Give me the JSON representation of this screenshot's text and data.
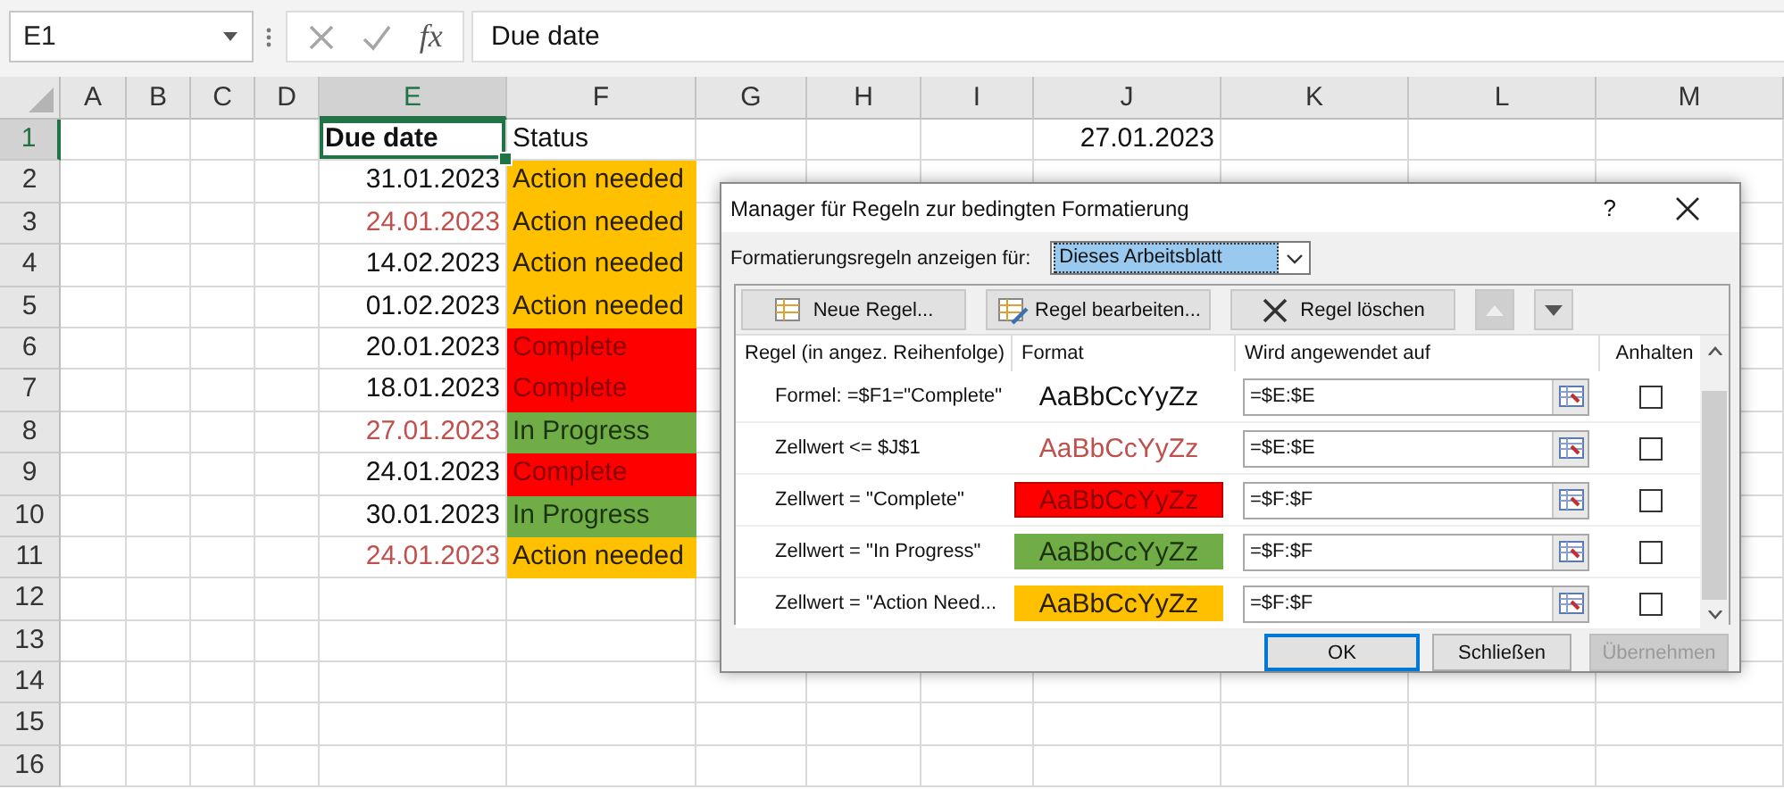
{
  "formula_bar": {
    "name_box": "E1",
    "function_label": "fx",
    "value": "Due date"
  },
  "columns": [
    "A",
    "B",
    "C",
    "D",
    "E",
    "F",
    "G",
    "H",
    "I",
    "J",
    "K",
    "L",
    "M"
  ],
  "rows": [
    {
      "number": "1",
      "cells": [
        null,
        null,
        null,
        null,
        {
          "text": "Due date",
          "kind": "heading",
          "selected": true
        },
        {
          "text": "Status",
          "kind": "label",
          "selected": false
        },
        null,
        null,
        null,
        {
          "text": "27.01.2023",
          "kind": "date",
          "overdue": false,
          "selected": false
        }
      ]
    },
    {
      "number": "2",
      "cells": [
        null,
        null,
        null,
        null,
        {
          "text": "31.01.2023",
          "kind": "date",
          "overdue": false,
          "selected": false
        },
        {
          "text": "Action needed",
          "kind": "action-needed",
          "selected": false
        }
      ]
    },
    {
      "number": "3",
      "cells": [
        null,
        null,
        null,
        null,
        {
          "text": "24.01.2023",
          "kind": "date",
          "overdue": true,
          "selected": false
        },
        {
          "text": "Action needed",
          "kind": "action-needed",
          "selected": false
        }
      ]
    },
    {
      "number": "4",
      "cells": [
        null,
        null,
        null,
        null,
        {
          "text": "14.02.2023",
          "kind": "date",
          "overdue": false,
          "selected": false
        },
        {
          "text": "Action needed",
          "kind": "action-needed",
          "selected": false
        }
      ]
    },
    {
      "number": "5",
      "cells": [
        null,
        null,
        null,
        null,
        {
          "text": "01.02.2023",
          "kind": "date",
          "overdue": false,
          "selected": false
        },
        {
          "text": "Action needed",
          "kind": "action-needed",
          "selected": false
        }
      ]
    },
    {
      "number": "6",
      "cells": [
        null,
        null,
        null,
        null,
        {
          "text": "20.01.2023",
          "kind": "date",
          "overdue": false,
          "selected": false
        },
        {
          "text": "Complete",
          "kind": "complete",
          "selected": false
        }
      ]
    },
    {
      "number": "7",
      "cells": [
        null,
        null,
        null,
        null,
        {
          "text": "18.01.2023",
          "kind": "date",
          "overdue": false,
          "selected": false
        },
        {
          "text": "Complete",
          "kind": "complete",
          "selected": false
        }
      ]
    },
    {
      "number": "8",
      "cells": [
        null,
        null,
        null,
        null,
        {
          "text": "27.01.2023",
          "kind": "date",
          "overdue": true,
          "selected": false
        },
        {
          "text": "In Progress",
          "kind": "in-progress",
          "selected": false
        }
      ]
    },
    {
      "number": "9",
      "cells": [
        null,
        null,
        null,
        null,
        {
          "text": "24.01.2023",
          "kind": "date",
          "overdue": false,
          "selected": false
        },
        {
          "text": "Complete",
          "kind": "complete",
          "selected": false
        }
      ]
    },
    {
      "number": "10",
      "cells": [
        null,
        null,
        null,
        null,
        {
          "text": "30.01.2023",
          "kind": "date",
          "overdue": false,
          "selected": false
        },
        {
          "text": "In Progress",
          "kind": "in-progress",
          "selected": false
        }
      ]
    },
    {
      "number": "11",
      "cells": [
        null,
        null,
        null,
        null,
        {
          "text": "24.01.2023",
          "kind": "date",
          "overdue": true,
          "selected": false
        },
        {
          "text": "Action needed",
          "kind": "action-needed",
          "selected": false
        }
      ]
    },
    {
      "number": "12",
      "cells": []
    },
    {
      "number": "13",
      "cells": []
    },
    {
      "number": "14",
      "cells": []
    },
    {
      "number": "15",
      "cells": []
    },
    {
      "number": "16",
      "cells": []
    }
  ],
  "dialog": {
    "title": "Manager für Regeln zur bedingten Formatierung",
    "help": "?",
    "scope_label": "Formatierungsregeln anzeigen für:",
    "scope_value": "Dieses Arbeitsblatt",
    "toolbar": [
      {
        "kind": "new",
        "label": "Neue Regel...",
        "disabled": false
      },
      {
        "kind": "edit",
        "label": "Regel bearbeiten...",
        "disabled": false
      },
      {
        "kind": "delete",
        "label": "Regel löschen",
        "disabled": false
      },
      {
        "kind": "up",
        "disabled": true
      },
      {
        "kind": "down",
        "disabled": false
      }
    ],
    "columns": [
      "Regel (in angez. Reihenfolge)",
      "Format",
      "Wird angewendet auf",
      "Anhalten"
    ],
    "rules": [
      {
        "rule": "Formel: =$F1=\"Complete\"",
        "preview": "AaBbCcYyZz",
        "kind": "plain",
        "applies_to": "=$E:$E",
        "checked": false,
        "selected": false
      },
      {
        "rule": "Zellwert <= $J$1",
        "preview": "AaBbCcYyZz",
        "kind": "red-text",
        "applies_to": "=$E:$E",
        "checked": false,
        "selected": false
      },
      {
        "rule": "Zellwert = \"Complete\"",
        "preview": "AaBbCcYyZz",
        "kind": "red-fill",
        "applies_to": "=$F:$F",
        "checked": false,
        "selected": false
      },
      {
        "rule": "Zellwert = \"In Progress\"",
        "preview": "AaBbCcYyZz",
        "kind": "green-fill",
        "applies_to": "=$F:$F",
        "checked": false,
        "selected": false
      },
      {
        "rule": "Zellwert = \"Action Need...",
        "preview": "AaBbCcYyZz",
        "kind": "orange-fill",
        "applies_to": "=$F:$F",
        "checked": false,
        "selected": false
      }
    ],
    "buttons": [
      {
        "label": "OK",
        "default": true,
        "disabled": false
      },
      {
        "label": "Schließen",
        "default": false,
        "disabled": false
      },
      {
        "label": "Übernehmen",
        "default": false,
        "disabled": true
      }
    ]
  }
}
